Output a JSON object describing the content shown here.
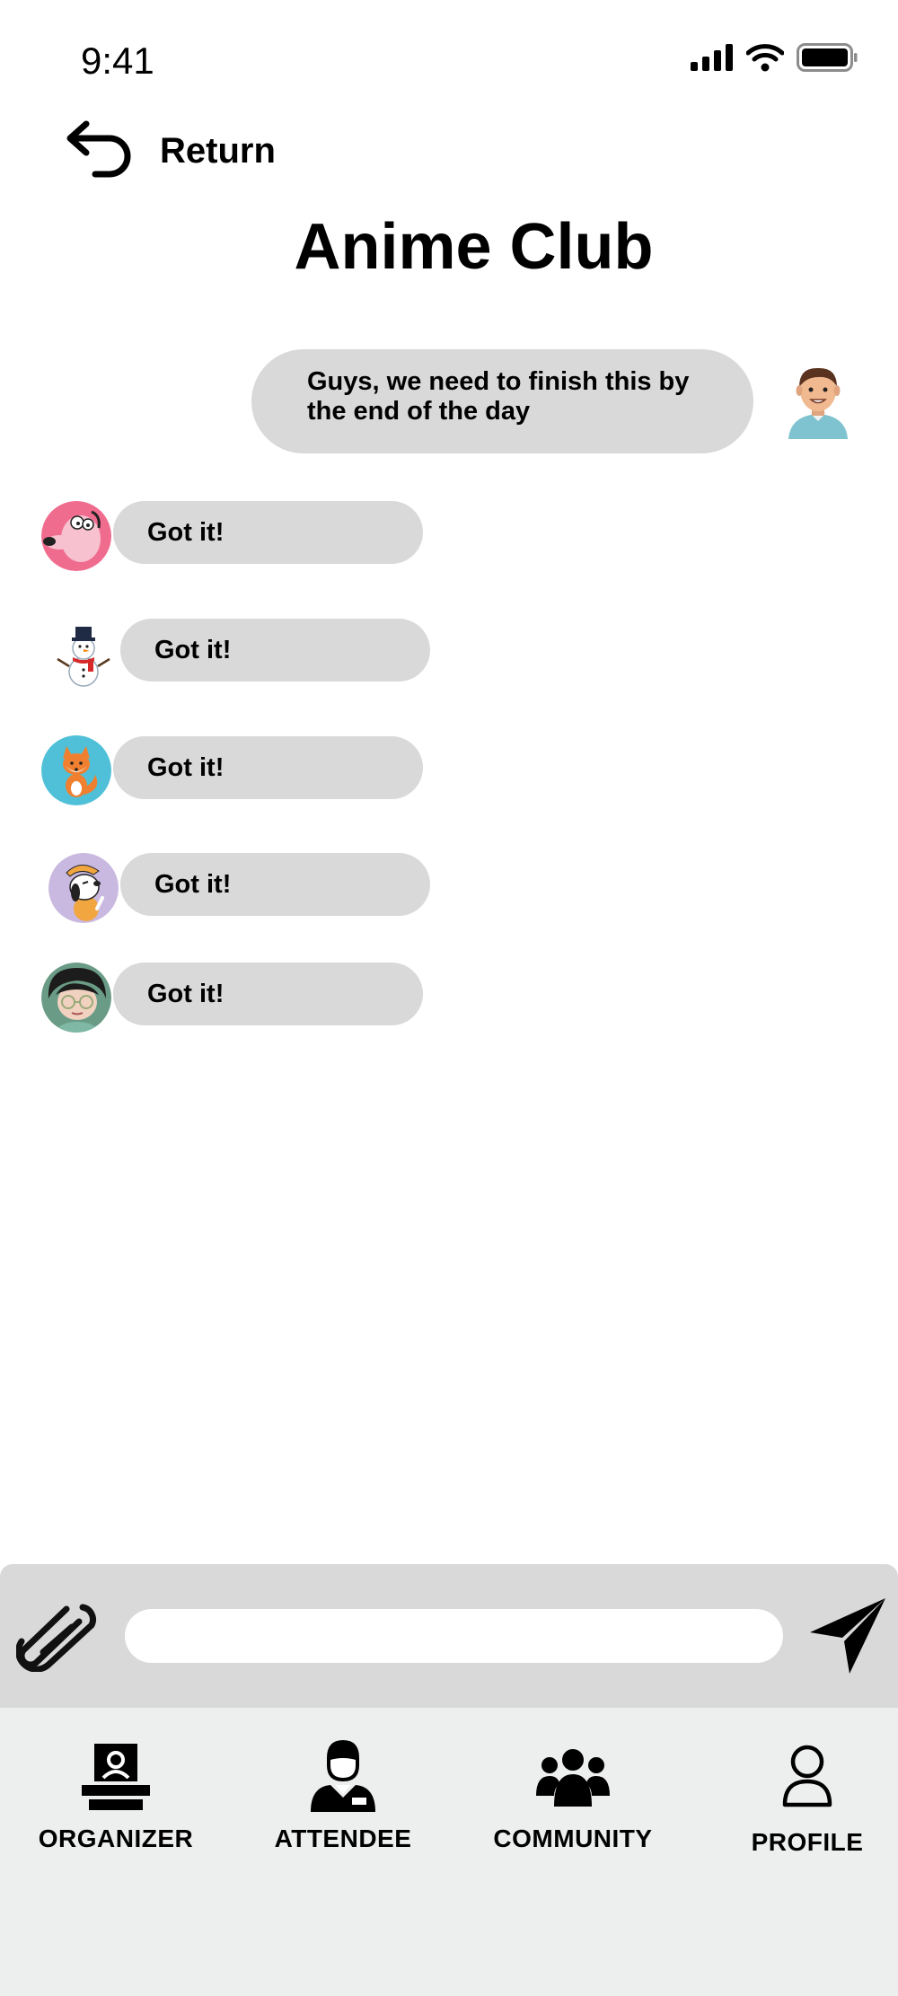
{
  "status_bar": {
    "time": "9:41"
  },
  "header": {
    "return_label": "Return",
    "title": "Anime Club"
  },
  "chat": {
    "outgoing": {
      "text": "Guys, we need to finish this by the end of the day",
      "avatar": "man-avatar"
    },
    "incoming": [
      {
        "text": "Got it!",
        "avatar": "pink-dog-avatar"
      },
      {
        "text": "Got it!",
        "avatar": "snowman-avatar"
      },
      {
        "text": "Got it!",
        "avatar": "fox-avatar"
      },
      {
        "text": "Got it!",
        "avatar": "cartoon-dog-avatar"
      },
      {
        "text": "Got it!",
        "avatar": "girl-avatar"
      }
    ]
  },
  "composer": {
    "placeholder": "",
    "attach_icon": "paperclip-icon",
    "send_icon": "paper-plane-icon"
  },
  "nav": {
    "items": [
      {
        "label": "ORGANIZER",
        "icon": "podium-icon"
      },
      {
        "label": "ATTENDEE",
        "icon": "person-badge-icon"
      },
      {
        "label": "COMMUNITY",
        "icon": "group-icon"
      },
      {
        "label": "PROFILE",
        "icon": "user-outline-icon"
      }
    ]
  },
  "colors": {
    "bubble": "#d9d9d9",
    "composer_bg": "#d9d9d9",
    "nav_bg": "#edeeee"
  }
}
